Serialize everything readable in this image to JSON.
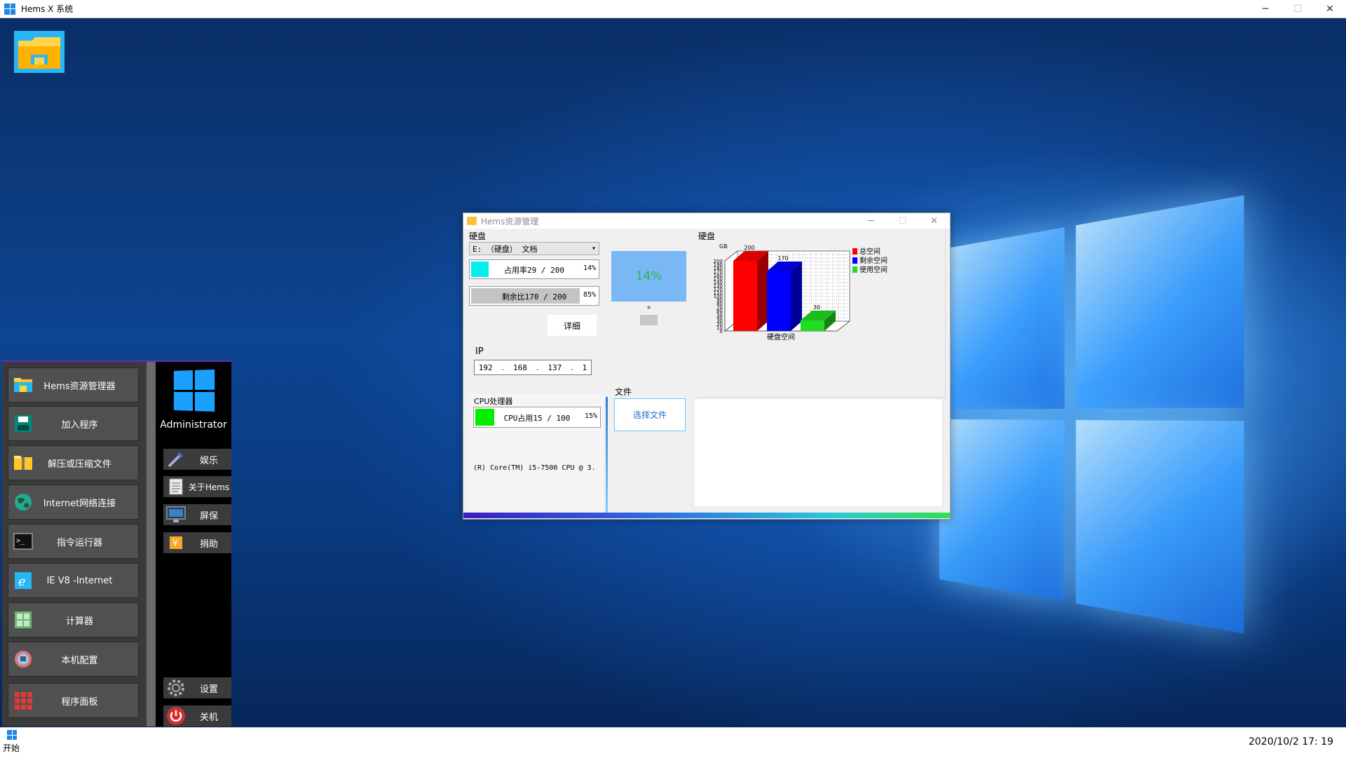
{
  "app": {
    "title": "Hems X 系统",
    "controls": [
      "─",
      "☐",
      "✕"
    ]
  },
  "taskbar": {
    "start_label": "开始",
    "clock": "2020/10/2 17: 19"
  },
  "start_menu": {
    "items": [
      {
        "label": "Hems资源管理器",
        "icon": "folder-icon"
      },
      {
        "label": "加入程序",
        "icon": "save-icon"
      },
      {
        "label": "解压或压缩文件",
        "icon": "archive-folder-icon"
      },
      {
        "label": "Internet网络连接",
        "icon": "globe-icon"
      },
      {
        "label": "指令运行器",
        "icon": "terminal-icon"
      },
      {
        "label": "IE V8 -Internet",
        "icon": "ie-icon"
      },
      {
        "label": "计算器",
        "icon": "calculator-icon"
      },
      {
        "label": "本机配置",
        "icon": "config-icon"
      },
      {
        "label": "程序面板",
        "icon": "grid-icon"
      }
    ],
    "user": "Administrator",
    "right_buttons": [
      {
        "label": "娱乐",
        "icon": "wand-icon"
      },
      {
        "label": "关于Hems",
        "icon": "document-icon"
      },
      {
        "label": "屏保",
        "icon": "monitor-icon"
      },
      {
        "label": "捐助",
        "icon": "yen-icon"
      }
    ],
    "settings_label": "设置",
    "shutdown_label": "关机"
  },
  "hems": {
    "title": "Hems资源管理",
    "disk_label": "硬盘",
    "drive_selected": "E: （硬盘） 文档",
    "usage_text": "占用率29 / 200",
    "usage_pct": "14%",
    "usage_fraction": 0.14,
    "remain_text": "剩余比170 / 200",
    "remain_pct": "85%",
    "remain_fraction": 0.85,
    "detail_label": "详细",
    "ip_label": "IP",
    "ip": [
      "192",
      "168",
      "137",
      "1"
    ],
    "cpu_label": "CPU处理器",
    "cpu_text": "CPU占用15 / 100",
    "cpu_pct": "15%",
    "cpu_fraction": 0.15,
    "cpu_info": "(R) Core(TM) i5-7500 CPU @ 3.",
    "big_pct": "14%",
    "chart_label": "硬盘",
    "file_label": "文件",
    "choose_file": "选择文件",
    "colors": {
      "usage": "#00f0f0",
      "remain": "#c4c4c4",
      "cpu": "#00ee00"
    }
  },
  "chart_data": {
    "type": "bar",
    "title": "",
    "xlabel": "硬盘空间",
    "ylabel": "GB",
    "ylim": [
      0,
      200
    ],
    "yticks": [
      "200",
      "190",
      "180",
      "170",
      "160",
      "150",
      "140",
      "130",
      "120",
      "110",
      "100",
      "90",
      "80",
      "70",
      "60",
      "50",
      "40",
      "30",
      "20",
      "10",
      "0"
    ],
    "grid": true,
    "legend_position": "top-right",
    "series": [
      {
        "name": "总空间",
        "values": [
          200
        ],
        "color": "#ff0000"
      },
      {
        "name": "剩余空间",
        "values": [
          170
        ],
        "color": "#0000ff"
      },
      {
        "name": "使用空间",
        "values": [
          30
        ],
        "color": "#22dd22"
      }
    ]
  }
}
